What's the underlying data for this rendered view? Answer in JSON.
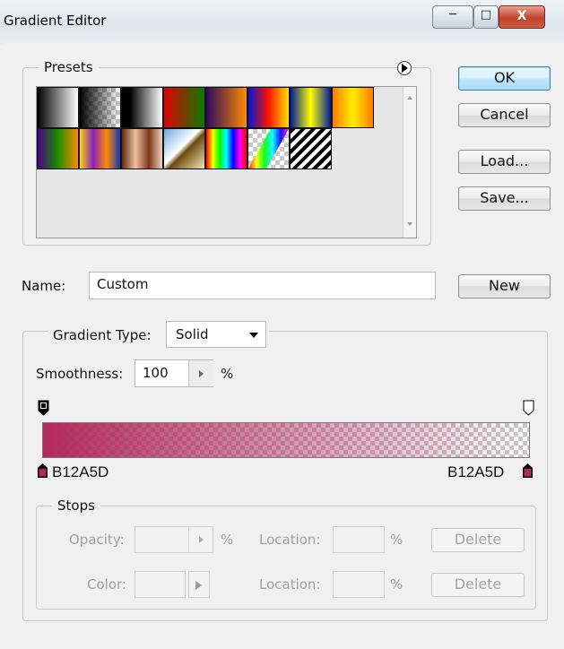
{
  "window": {
    "title": "Gradient Editor"
  },
  "presets": {
    "label": "Presets",
    "swatches": [
      "black-white",
      "foreground-transparent",
      "black-white-fade",
      "red-green",
      "violet-orange",
      "blue-red-yellow",
      "blue-yellow-blue",
      "orange-yellow-orange",
      "violet-green-orange",
      "yellow-violet-orange-blue",
      "copper",
      "chrome",
      "spectrum",
      "transparent-rainbow",
      "transparent-stripes"
    ]
  },
  "buttons": {
    "ok": "OK",
    "cancel": "Cancel",
    "load": "Load...",
    "save": "Save...",
    "new": "New"
  },
  "name_field": {
    "label": "Name:",
    "value": "Custom"
  },
  "gradient": {
    "type_label": "Gradient Type:",
    "type_value": "Solid",
    "smoothness_label": "Smoothness:",
    "smoothness_value": "100",
    "smoothness_unit": "%",
    "color_hex": "#b12a5d",
    "left_stop_label": "B12A5D",
    "right_stop_label": "B12A5D",
    "opacity_stops": [
      {
        "location": 0,
        "opacity": 100
      },
      {
        "location": 100,
        "opacity": 0
      }
    ]
  },
  "stops": {
    "label": "Stops",
    "opacity_label": "Opacity:",
    "color_label": "Color:",
    "location_label": "Location:",
    "percent": "%",
    "delete_label": "Delete"
  }
}
